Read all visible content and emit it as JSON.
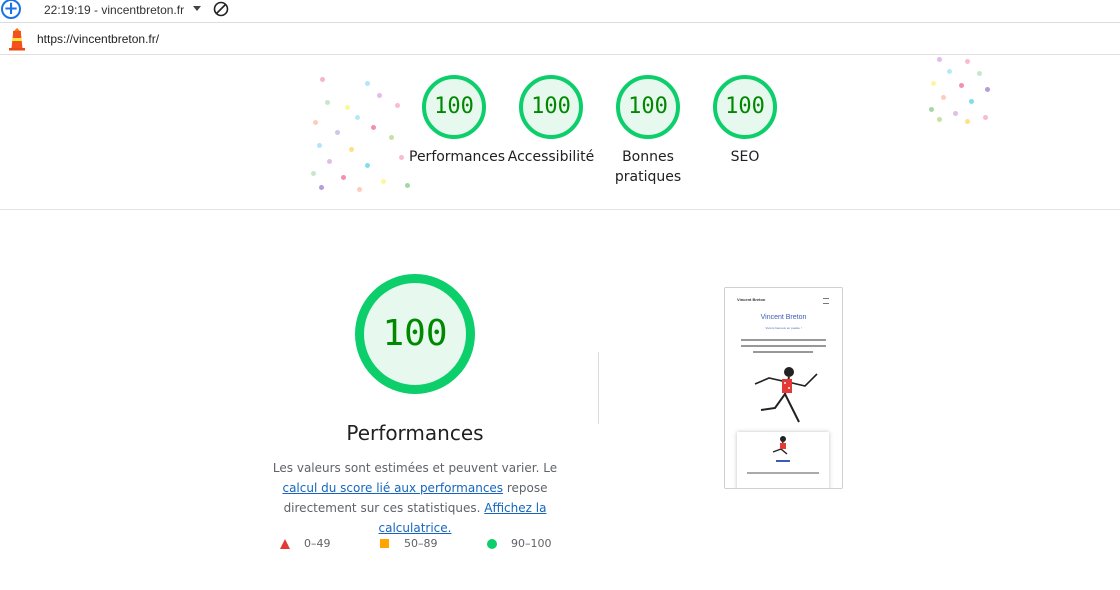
{
  "toolbar": {
    "new_button": "+",
    "report_selector": "22:19:19 - vincentbreton.fr"
  },
  "urlbar": {
    "url": "https://vincentbreton.fr/"
  },
  "gauges": [
    {
      "label": "Performances",
      "score": "100"
    },
    {
      "label": "Accessibilité",
      "score": "100"
    },
    {
      "label": "Bonnes pratiques",
      "score": "100"
    },
    {
      "label": "SEO",
      "score": "100"
    }
  ],
  "main": {
    "score": "100",
    "title": "Performances",
    "desc_prefix": "Les valeurs sont estimées et peuvent varier. Le ",
    "desc_link1": "calcul du score lié aux performances",
    "desc_middle": " repose directement sur ces statistiques. ",
    "desc_link2": "Affichez la calculatrice."
  },
  "legend": [
    {
      "range": "0–49",
      "color": "#e53935"
    },
    {
      "range": "50–89",
      "color": "#ffa400"
    },
    {
      "range": "90–100",
      "color": "#0cce6b"
    }
  ],
  "thumbnail": {
    "brand": "Vincent Breton",
    "title": "Vincent Breton",
    "subtitle": "Vivons heureux en poésie !"
  },
  "colors": {
    "pass": "#0cce6b",
    "pass_text": "#008800",
    "pass_bg": "#e7f8ee",
    "link": "#1565c0"
  }
}
